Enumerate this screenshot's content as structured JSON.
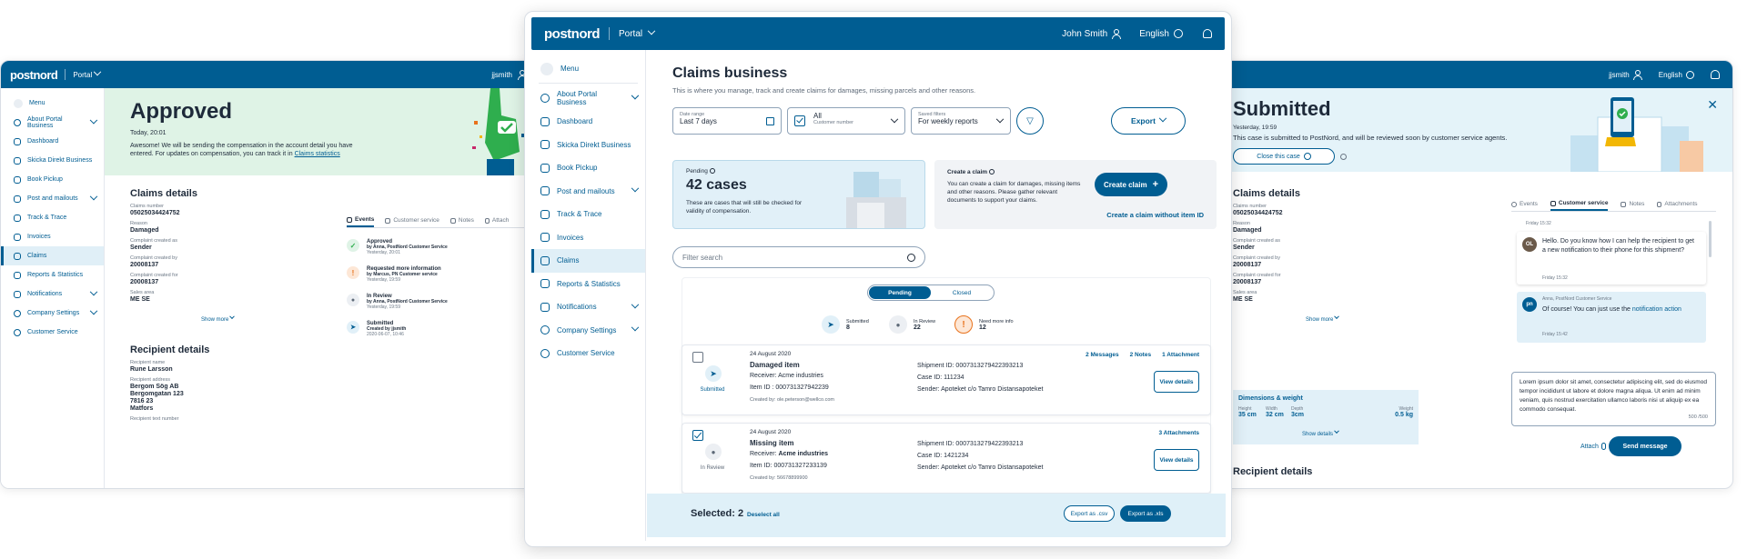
{
  "colors": {
    "brand": "#005d92",
    "success_bg": "#dff3e6",
    "info_bg": "#e1f0f8",
    "accent_green": "#2fae4e",
    "warning": "#e8721c"
  },
  "brand": {
    "logo": "postnord",
    "portal": "Portal"
  },
  "left": {
    "user": "jjsmith",
    "sidebar": [
      {
        "label": "Menu"
      },
      {
        "label": "About Portal Business"
      },
      {
        "label": "Dashboard"
      },
      {
        "label": "Skicka Direkt Business"
      },
      {
        "label": "Book Pickup"
      },
      {
        "label": "Post and mailouts"
      },
      {
        "label": "Track & Trace"
      },
      {
        "label": "Invoices"
      },
      {
        "label": "Claims"
      },
      {
        "label": "Reports & Statistics"
      },
      {
        "label": "Notifications"
      },
      {
        "label": "Company Settings"
      },
      {
        "label": "Customer Service"
      }
    ],
    "banner": {
      "title": "Approved",
      "date": "Today, 20:01",
      "message": "Awesome! We will be sending the compensation in the account detail you have entered. For updates on compensation, you can track it in",
      "link": "Claims statistics"
    },
    "details": {
      "title": "Claims details",
      "fields": [
        {
          "label": "Claims number",
          "value": "05025034424752"
        },
        {
          "label": "Reason",
          "value": "Damaged"
        },
        {
          "label": "Complaint created as",
          "value": "Sender"
        },
        {
          "label": "Complaint created by",
          "value": "20008137"
        },
        {
          "label": "Complaint created for",
          "value": "20008137"
        },
        {
          "label": "Sales area",
          "value": "ME SE"
        }
      ],
      "show_more": "Show more"
    },
    "recipient": {
      "title": "Recipient details",
      "name_label": "Recipient name",
      "name": "Rune Larsson",
      "address_label": "Recipient address",
      "address": [
        "Bergom Sög AB",
        "Bergomgatan 123",
        "7816 23",
        "Matfors"
      ],
      "phone_label": "Recipient text number"
    },
    "tabs": [
      "Events",
      "Customer service",
      "Notes",
      "Attach"
    ],
    "events": [
      {
        "title": "Approved",
        "by": "by Anna, PostNord Customer Service",
        "date": "Yesterday, 20:01"
      },
      {
        "title": "Requested more information",
        "by": "by Marcus, PN Customer service",
        "date": "Yesterday, 19:59"
      },
      {
        "title": "In Review",
        "by": "by Anna, PostNord Customer Service",
        "date": "Yesterday, 19:59"
      },
      {
        "title": "Submitted",
        "by": "Created by jjsmith",
        "date": "2020-06-07, 10:46"
      }
    ]
  },
  "center": {
    "user": "John Smith",
    "language": "English",
    "sidebar": [
      {
        "label": "Menu"
      },
      {
        "label": "About Portal Business"
      },
      {
        "label": "Dashboard"
      },
      {
        "label": "Skicka Direkt Business"
      },
      {
        "label": "Book Pickup"
      },
      {
        "label": "Post and mailouts"
      },
      {
        "label": "Track & Trace"
      },
      {
        "label": "Invoices"
      },
      {
        "label": "Claims"
      },
      {
        "label": "Reports & Statistics"
      },
      {
        "label": "Notifications"
      },
      {
        "label": "Company Settings"
      },
      {
        "label": "Customer Service"
      }
    ],
    "title": "Claims business",
    "subtitle": "This is where you manage, track and create claims for damages, missing parcels and other reasons.",
    "filters": {
      "date_label": "Date range",
      "date_value": "Last 7 days",
      "customer_value": "All",
      "customer_label": "Customer number",
      "saved_label": "Saved filters",
      "saved_value": "For weekly reports"
    },
    "export": "Export",
    "pending": {
      "label": "Pending",
      "count": "42 cases",
      "desc": "These are cases that will still be checked for validity of compensation."
    },
    "create": {
      "label": "Create a claim",
      "desc": "You can create a claim for damages, missing items and other reasons. Please gather relevant documents to support your claims.",
      "button": "Create claim",
      "link": "Create a claim without item ID"
    },
    "search_placeholder": "Filter search",
    "segment": [
      "Pending",
      "Closed"
    ],
    "stats": [
      {
        "label": "Submitted",
        "value": "8"
      },
      {
        "label": "In Review",
        "value": "22"
      },
      {
        "label": "Need more info",
        "value": "12"
      }
    ],
    "cards": [
      {
        "status": "Submitted",
        "date": "24 August 2020",
        "title": "Damaged item",
        "receiver_label": "Receiver:",
        "receiver": "Acme industries",
        "item_id": "Item ID : 000731327942239",
        "created_by": "Created by: ole.peterson@wellco.com",
        "shipment_label": "Shipment ID:",
        "shipment": "0007313279422393213",
        "case": "Case ID: 111234",
        "sender_label": "Sender:",
        "sender": "Apoteket c/o Tamro Distansapoteket",
        "meta": [
          "2 Messages",
          "2 Notes",
          "1 Attachment"
        ],
        "action": "View details"
      },
      {
        "status": "In Review",
        "date": "24 August 2020",
        "title": "Missing item",
        "receiver_label": "Receiver:",
        "receiver": "Acme industries",
        "item_id": "Item ID: 000731327233139",
        "created_by": "Created by: 56678899900",
        "shipment_label": "Shipment ID:",
        "shipment": "0007313279422393213",
        "case": "Case ID: 1421234",
        "sender_label": "Sender:",
        "sender": "Apoteket c/o Tamro Distansapoteket",
        "meta": [
          "3 Attachments"
        ],
        "action": "View details"
      }
    ],
    "selection": {
      "text": "Selected: 2",
      "deselect": "Deselect all",
      "export_csv": "Export as .csv",
      "export_xls": "Export as .xls"
    }
  },
  "right": {
    "user": "jjsmith",
    "language": "English",
    "banner": {
      "title": "Submitted",
      "date": "Yesterday, 19:59",
      "message": "This case is submitted to PostNord, and will be reviewed soon by customer service agents.",
      "close": "Close this case"
    },
    "details": {
      "title": "Claims details",
      "fields": [
        {
          "label": "Claims number",
          "value": "05025034424752"
        },
        {
          "label": "Reason",
          "value": "Damaged"
        },
        {
          "label": "Complaint created as",
          "value": "Sender"
        },
        {
          "label": "Complaint created by",
          "value": "20008137"
        },
        {
          "label": "Complaint created for",
          "value": "20008137"
        },
        {
          "label": "Sales area",
          "value": "ME SE"
        }
      ],
      "show_more": "Show more"
    },
    "dims": {
      "title": "Dimensions & weight",
      "cols": [
        {
          "label": "Height",
          "value": "35 cm"
        },
        {
          "label": "Width",
          "value": "32 cm"
        },
        {
          "label": "Depth",
          "value": "3cm"
        }
      ],
      "weight_label": "Weight",
      "weight": "0.5 kg",
      "show_details": "Show details"
    },
    "recipient_title": "Recipient details",
    "tabs": [
      "Events",
      "Customer service",
      "Notes",
      "Attachments"
    ],
    "chat": {
      "top_time": "Friday 15:32",
      "msg1_avatar": "OL",
      "msg1": "Hello. Do you know how I can help the recipient to get a new notification to their phone for this shipment?",
      "msg1_time": "Friday 15:32",
      "msg2_avatar": "pn",
      "msg2_author": "Anna, PostNord Customer Service",
      "msg2_text": "Of course! You can just use the",
      "msg2_link": "notification action",
      "msg2_time": "Friday 15:42"
    },
    "compose": "Lorem ipsum dolor sit amet, consectetur adipiscing elit, sed do eiusmod tempor incididunt ut labore et dolore magna aliqua. Ut enim ad minim veniam, quis nostrud exercitation ullamco laboris nisi ut aliquip ex ea commodo consequat.",
    "counter": "500 /500",
    "attach": "Attach",
    "send": "Send message"
  }
}
